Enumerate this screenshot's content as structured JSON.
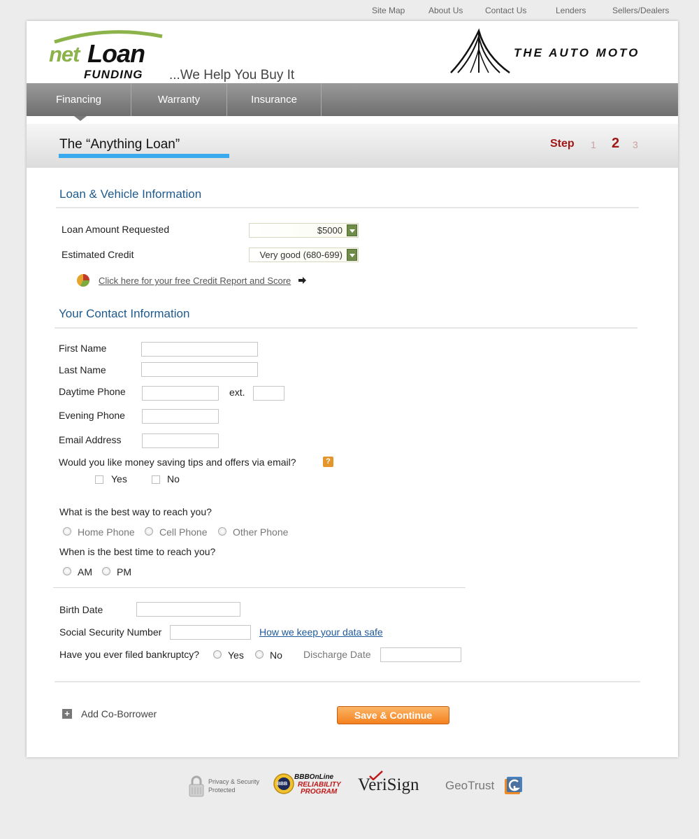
{
  "top_links": [
    "Site Map",
    "About Us",
    "Contact Us",
    "Lenders",
    "Sellers/Dealers"
  ],
  "brand": {
    "net": "net",
    "loan": "Loan",
    "funding": "FUNDING",
    "tagline": "...We Help You Buy It",
    "partner": "THE AUTO MOTO"
  },
  "nav": {
    "tabs": [
      "Financing",
      "Warranty",
      "Insurance"
    ],
    "active": "Financing"
  },
  "page": {
    "title": "The “Anything Loan”",
    "step_label": "Step",
    "steps": [
      "1",
      "2",
      "3"
    ],
    "current_step": "2"
  },
  "loan_section": {
    "heading": "Loan & Vehicle Information",
    "loan_amount_label": "Loan Amount Requested",
    "loan_amount_value": "$5000",
    "credit_label": "Estimated Credit",
    "credit_value": "Very good (680-699)",
    "credit_report_link": "Click here for your free Credit Report and Score"
  },
  "contact_section": {
    "heading": "Your Contact Information",
    "first_name": "First Name",
    "last_name": "Last Name",
    "daytime_phone": "Daytime Phone",
    "ext": "ext.",
    "evening_phone": "Evening Phone",
    "email": "Email Address",
    "tips_question": "Would you like money saving tips and offers via email?",
    "help_glyph": "?",
    "yes": "Yes",
    "no": "No",
    "reach_question": "What is the best way to reach you?",
    "reach_options": [
      "Home Phone",
      "Cell Phone",
      "Other Phone"
    ],
    "time_question": "When is the best time to reach you?",
    "time_options": [
      "AM",
      "PM"
    ]
  },
  "personal_section": {
    "birth_date": "Birth Date",
    "ssn": "Social Security Number",
    "data_safe_link": "How we keep your data safe",
    "bankruptcy_question": "Have you ever filed bankruptcy?",
    "yes": "Yes",
    "no": "No",
    "discharge_date": "Discharge Date"
  },
  "actions": {
    "add_coborrower": "Add Co-Borrower",
    "plus_glyph": "+",
    "save": "Save & Continue"
  },
  "trust_badges": {
    "privacy_line1": "Privacy & Security",
    "privacy_line2": "Protected",
    "bbb_top": "BBBOnLine",
    "bbb_line1": "RELIABILITY",
    "bbb_line2": "PROGRAM",
    "bbb_seal": "BBB",
    "verisign": "VeriSign",
    "geotrust": "GeoTrust"
  },
  "colors": {
    "accent_blue": "#1e5a8c",
    "step_red": "#a01818",
    "save_orange": "#f4811e",
    "brand_green": "#8cb24a"
  }
}
